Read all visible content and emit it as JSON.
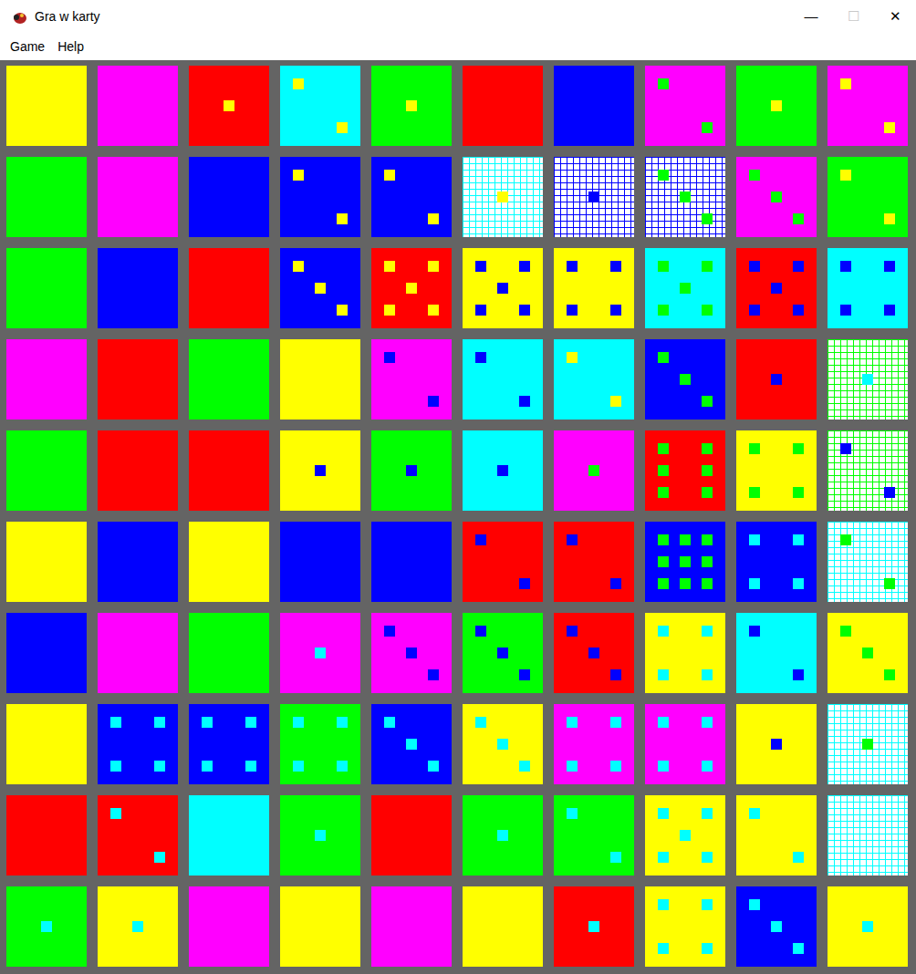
{
  "window": {
    "title": "Gra w karty",
    "controls": [
      "—",
      "☐",
      "✕"
    ]
  },
  "menu": [
    "Game",
    "Help"
  ],
  "board": [
    [
      {
        "color": "#ffff00",
        "kind": "solid",
        "dots": 0
      },
      {
        "color": "#ff00ff",
        "kind": "solid",
        "dots": 0
      },
      {
        "color": "#ff0000",
        "kind": "solid",
        "dots": 1,
        "dot_color": "#ffff00"
      },
      {
        "color": "#00ffff",
        "kind": "solid",
        "dots": 2,
        "dot_color": "#ffff00"
      },
      {
        "color": "#00ff00",
        "kind": "solid",
        "dots": 1,
        "dot_color": "#ffff00"
      },
      {
        "color": "#ff0000",
        "kind": "solid",
        "dots": 0
      },
      {
        "color": "#0000ff",
        "kind": "solid",
        "dots": 0
      },
      {
        "color": "#ff00ff",
        "kind": "solid",
        "dots": 2,
        "dot_color": "#00ff00"
      },
      {
        "color": "#00ff00",
        "kind": "solid",
        "dots": 1,
        "dot_color": "#ffff00"
      },
      {
        "color": "#ff00ff",
        "kind": "solid",
        "dots": 2,
        "dot_color": "#ffff00"
      }
    ],
    [
      {
        "color": "#00ff00",
        "kind": "solid",
        "dots": 0
      },
      {
        "color": "#ff00ff",
        "kind": "solid",
        "dots": 0
      },
      {
        "color": "#0000ff",
        "kind": "solid",
        "dots": 0
      },
      {
        "color": "#0000ff",
        "kind": "solid",
        "dots": 2,
        "dot_color": "#ffff00"
      },
      {
        "color": "#0000ff",
        "kind": "solid",
        "dots": 2,
        "dot_color": "#ffff00"
      },
      {
        "color": "#00ffff",
        "kind": "mesh",
        "dots": 1,
        "dot_color": "#ffff00"
      },
      {
        "color": "#0000ff",
        "kind": "mesh",
        "dots": 1,
        "dot_color": "#0000ff"
      },
      {
        "color": "#0000ff",
        "kind": "mesh",
        "dots": 3,
        "dot_color": "#00ff00"
      },
      {
        "color": "#ff00ff",
        "kind": "solid",
        "dots": 3,
        "dot_color": "#00ff00"
      },
      {
        "color": "#00ff00",
        "kind": "solid",
        "dots": 2,
        "dot_color": "#ffff00"
      }
    ],
    [
      {
        "color": "#00ff00",
        "kind": "solid",
        "dots": 0
      },
      {
        "color": "#0000ff",
        "kind": "solid",
        "dots": 0
      },
      {
        "color": "#ff0000",
        "kind": "solid",
        "dots": 0
      },
      {
        "color": "#0000ff",
        "kind": "solid",
        "dots": 3,
        "dot_color": "#ffff00"
      },
      {
        "color": "#ff0000",
        "kind": "solid",
        "dots": 5,
        "dot_color": "#ffff00"
      },
      {
        "color": "#ffff00",
        "kind": "solid",
        "dots": 5,
        "dot_color": "#0000ff"
      },
      {
        "color": "#ffff00",
        "kind": "solid",
        "dots": 4,
        "dot_color": "#0000ff"
      },
      {
        "color": "#00ffff",
        "kind": "solid",
        "dots": 5,
        "dot_color": "#00ff00"
      },
      {
        "color": "#ff0000",
        "kind": "solid",
        "dots": 5,
        "dot_color": "#0000ff"
      },
      {
        "color": "#00ffff",
        "kind": "solid",
        "dots": 4,
        "dot_color": "#0000ff"
      }
    ],
    [
      {
        "color": "#ff00ff",
        "kind": "solid",
        "dots": 0
      },
      {
        "color": "#ff0000",
        "kind": "solid",
        "dots": 0
      },
      {
        "color": "#00ff00",
        "kind": "solid",
        "dots": 0
      },
      {
        "color": "#ffff00",
        "kind": "solid",
        "dots": 0
      },
      {
        "color": "#ff00ff",
        "kind": "solid",
        "dots": 2,
        "dot_color": "#0000ff"
      },
      {
        "color": "#00ffff",
        "kind": "solid",
        "dots": 2,
        "dot_color": "#0000ff"
      },
      {
        "color": "#00ffff",
        "kind": "solid",
        "dots": 2,
        "dot_color": "#ffff00"
      },
      {
        "color": "#0000ff",
        "kind": "solid",
        "dots": 3,
        "dot_color": "#00ff00"
      },
      {
        "color": "#ff0000",
        "kind": "solid",
        "dots": 1,
        "dot_color": "#0000ff"
      },
      {
        "color": "#00ff00",
        "kind": "mesh",
        "dots": 1,
        "dot_color": "#00ffff"
      }
    ],
    [
      {
        "color": "#00ff00",
        "kind": "solid",
        "dots": 0
      },
      {
        "color": "#ff0000",
        "kind": "solid",
        "dots": 0
      },
      {
        "color": "#ff0000",
        "kind": "solid",
        "dots": 0
      },
      {
        "color": "#ffff00",
        "kind": "solid",
        "dots": 1,
        "dot_color": "#0000ff"
      },
      {
        "color": "#00ff00",
        "kind": "solid",
        "dots": 1,
        "dot_color": "#0000ff"
      },
      {
        "color": "#00ffff",
        "kind": "solid",
        "dots": 1,
        "dot_color": "#0000ff"
      },
      {
        "color": "#ff00ff",
        "kind": "solid",
        "dots": 1,
        "dot_color": "#00ff00"
      },
      {
        "color": "#ff0000",
        "kind": "solid",
        "dots": 6,
        "dot_color": "#00ff00"
      },
      {
        "color": "#ffff00",
        "kind": "solid",
        "dots": 4,
        "dot_color": "#00ff00"
      },
      {
        "color": "#00ff00",
        "kind": "mesh",
        "dots": 2,
        "dot_color": "#0000ff"
      }
    ],
    [
      {
        "color": "#ffff00",
        "kind": "solid",
        "dots": 0
      },
      {
        "color": "#0000ff",
        "kind": "solid",
        "dots": 0
      },
      {
        "color": "#ffff00",
        "kind": "solid",
        "dots": 0
      },
      {
        "color": "#0000ff",
        "kind": "solid",
        "dots": 0
      },
      {
        "color": "#0000ff",
        "kind": "solid",
        "dots": 0
      },
      {
        "color": "#ff0000",
        "kind": "solid",
        "dots": 2,
        "dot_color": "#0000ff"
      },
      {
        "color": "#ff0000",
        "kind": "solid",
        "dots": 2,
        "dot_color": "#0000ff"
      },
      {
        "color": "#0000ff",
        "kind": "solid",
        "dots": 9,
        "dot_color": "#00ff00"
      },
      {
        "color": "#0000ff",
        "kind": "solid",
        "dots": 4,
        "dot_color": "#00ffff"
      },
      {
        "color": "#00ffff",
        "kind": "mesh",
        "dots": 2,
        "dot_color": "#00ff00"
      }
    ],
    [
      {
        "color": "#0000ff",
        "kind": "solid",
        "dots": 0
      },
      {
        "color": "#ff00ff",
        "kind": "solid",
        "dots": 0
      },
      {
        "color": "#00ff00",
        "kind": "solid",
        "dots": 0
      },
      {
        "color": "#ff00ff",
        "kind": "solid",
        "dots": 1,
        "dot_color": "#00ffff"
      },
      {
        "color": "#ff00ff",
        "kind": "solid",
        "dots": 3,
        "dot_color": "#0000ff"
      },
      {
        "color": "#00ff00",
        "kind": "solid",
        "dots": 3,
        "dot_color": "#0000ff"
      },
      {
        "color": "#ff0000",
        "kind": "solid",
        "dots": 3,
        "dot_color": "#0000ff"
      },
      {
        "color": "#ffff00",
        "kind": "solid",
        "dots": 4,
        "dot_color": "#00ffff"
      },
      {
        "color": "#00ffff",
        "kind": "solid",
        "dots": 2,
        "dot_color": "#0000ff"
      },
      {
        "color": "#ffff00",
        "kind": "solid",
        "dots": 3,
        "dot_color": "#00ff00"
      }
    ],
    [
      {
        "color": "#ffff00",
        "kind": "solid",
        "dots": 0
      },
      {
        "color": "#0000ff",
        "kind": "solid",
        "dots": 4,
        "dot_color": "#00ffff"
      },
      {
        "color": "#0000ff",
        "kind": "solid",
        "dots": 4,
        "dot_color": "#00ffff"
      },
      {
        "color": "#00ff00",
        "kind": "solid",
        "dots": 4,
        "dot_color": "#00ffff"
      },
      {
        "color": "#0000ff",
        "kind": "solid",
        "dots": 3,
        "dot_color": "#00ffff"
      },
      {
        "color": "#ffff00",
        "kind": "solid",
        "dots": 3,
        "dot_color": "#00ffff"
      },
      {
        "color": "#ff00ff",
        "kind": "solid",
        "dots": 4,
        "dot_color": "#00ffff"
      },
      {
        "color": "#ff00ff",
        "kind": "solid",
        "dots": 4,
        "dot_color": "#00ffff"
      },
      {
        "color": "#ffff00",
        "kind": "solid",
        "dots": 1,
        "dot_color": "#0000ff"
      },
      {
        "color": "#00ffff",
        "kind": "mesh",
        "dots": 1,
        "dot_color": "#00ff00"
      }
    ],
    [
      {
        "color": "#ff0000",
        "kind": "solid",
        "dots": 0
      },
      {
        "color": "#ff0000",
        "kind": "solid",
        "dots": 2,
        "dot_color": "#00ffff"
      },
      {
        "color": "#00ffff",
        "kind": "solid",
        "dots": 0
      },
      {
        "color": "#00ff00",
        "kind": "solid",
        "dots": 1,
        "dot_color": "#00ffff"
      },
      {
        "color": "#ff0000",
        "kind": "solid",
        "dots": 0
      },
      {
        "color": "#00ff00",
        "kind": "solid",
        "dots": 1,
        "dot_color": "#00ffff"
      },
      {
        "color": "#00ff00",
        "kind": "solid",
        "dots": 2,
        "dot_color": "#00ffff"
      },
      {
        "color": "#ffff00",
        "kind": "solid",
        "dots": 5,
        "dot_color": "#00ffff"
      },
      {
        "color": "#ffff00",
        "kind": "solid",
        "dots": 2,
        "dot_color": "#00ffff"
      },
      {
        "color": "#00ffff",
        "kind": "mesh",
        "dots": 0
      }
    ],
    [
      {
        "color": "#00ff00",
        "kind": "solid",
        "dots": 1,
        "dot_color": "#00ffff"
      },
      {
        "color": "#ffff00",
        "kind": "solid",
        "dots": 1,
        "dot_color": "#00ffff"
      },
      {
        "color": "#ff00ff",
        "kind": "solid",
        "dots": 0
      },
      {
        "color": "#ffff00",
        "kind": "solid",
        "dots": 0
      },
      {
        "color": "#ff00ff",
        "kind": "solid",
        "dots": 0
      },
      {
        "color": "#ffff00",
        "kind": "solid",
        "dots": 0
      },
      {
        "color": "#ff0000",
        "kind": "solid",
        "dots": 1,
        "dot_color": "#00ffff"
      },
      {
        "color": "#ffff00",
        "kind": "solid",
        "dots": 4,
        "dot_color": "#00ffff"
      },
      {
        "color": "#0000ff",
        "kind": "solid",
        "dots": 3,
        "dot_color": "#00ffff"
      },
      {
        "color": "#ffff00",
        "kind": "solid",
        "dots": 1,
        "dot_color": "#00ffff"
      }
    ]
  ]
}
